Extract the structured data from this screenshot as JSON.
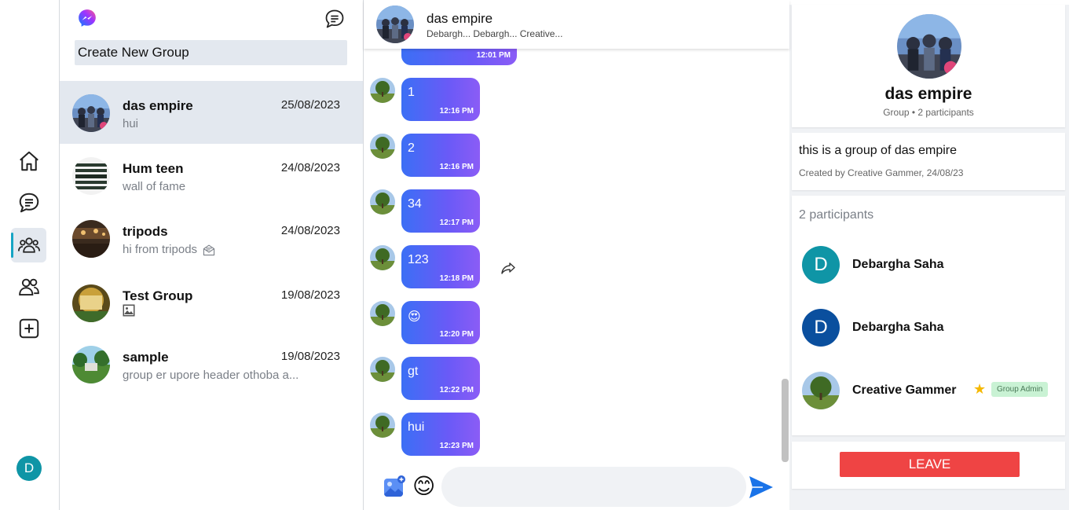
{
  "rail": {
    "items": [
      {
        "name": "home-icon"
      },
      {
        "name": "chat-icon"
      },
      {
        "name": "groups-icon",
        "active": true
      },
      {
        "name": "people-icon"
      },
      {
        "name": "add-icon"
      }
    ],
    "user_initial": "D"
  },
  "list": {
    "create_label": "Create New Group",
    "conversations": [
      {
        "name": "das empire",
        "date": "25/08/2023",
        "preview": "hui",
        "selected": true
      },
      {
        "name": "Hum teen",
        "date": "24/08/2023",
        "preview": "wall of fame"
      },
      {
        "name": "tripods",
        "date": "24/08/2023",
        "preview": "hi from tripods",
        "preview_icon": "envelope-icon"
      },
      {
        "name": "Test Group",
        "date": "19/08/2023",
        "preview": "",
        "preview_icon": "image-icon"
      },
      {
        "name": "sample",
        "date": "19/08/2023",
        "preview": "group er upore header othoba a..."
      }
    ]
  },
  "chat": {
    "title": "das empire",
    "subtitle": "Debargh... Debargh... Creative...",
    "partial_time": "12:01 PM",
    "messages": [
      {
        "text": "1",
        "time": "12:16 PM"
      },
      {
        "text": "2",
        "time": "12:16 PM"
      },
      {
        "text": "34",
        "time": "12:17 PM"
      },
      {
        "text": "123",
        "time": "12:18 PM"
      },
      {
        "text": "😍",
        "time": "12:20 PM"
      },
      {
        "text": "gt",
        "time": "12:22 PM"
      },
      {
        "text": "hui",
        "time": "12:23 PM"
      }
    ],
    "input_placeholder": "",
    "emoji": "😊"
  },
  "info": {
    "name": "das empire",
    "meta": "Group • 2 participants",
    "description": "this is a group of das empire",
    "created": "Created by Creative Gammer, 24/08/23",
    "participants_label": "2 participants",
    "participants": [
      {
        "initial": "D",
        "name": "Debargha Saha",
        "color": "#0f95a6"
      },
      {
        "initial": "D",
        "name": "Debargha Saha",
        "color": "#0a4f9e"
      },
      {
        "initial": "",
        "name": "Creative Gammer",
        "admin_label": "Group Admin"
      }
    ],
    "leave_label": "LEAVE"
  },
  "colors": {
    "accent": "#16a4c4",
    "bubble_start": "#3b6ff5",
    "bubble_end": "#8b5cf6",
    "danger": "#ef4444",
    "selected_bg": "#e3e8ef"
  }
}
